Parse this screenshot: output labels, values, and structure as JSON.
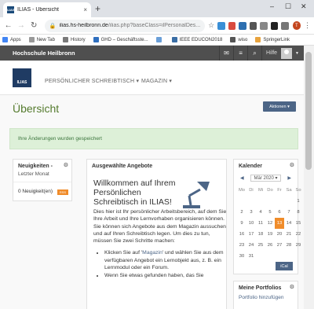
{
  "browser": {
    "tab_title": "ILIAS - Übersicht",
    "tab_favicon": "ILIAS",
    "tab_close": "×",
    "new_tab": "+",
    "window_controls": [
      "–",
      "☐",
      "✕"
    ],
    "nav": {
      "back": "←",
      "forward": "→",
      "reload": "↻"
    },
    "url_host": "ilias.hs-heilbronn.de",
    "url_path": "/ilias.php?baseClass=ilPersonalDes...",
    "profile_initial": "T",
    "bookmarks": [
      {
        "label": "Apps",
        "color": "#4285f4"
      },
      {
        "label": "New Tab",
        "color": "#999999"
      },
      {
        "label": "History",
        "color": "#7a7a7a"
      },
      {
        "label": "GHD – Geschäftsste...",
        "color": "#2f6fbf"
      },
      {
        "label": "",
        "color": "#6a9fd8"
      },
      {
        "label": "IEEE EDUCON2018",
        "color": "#3a6ea5"
      },
      {
        "label": "wiso",
        "color": "#555555"
      },
      {
        "label": "SpringerLink",
        "color": "#e8a33d"
      }
    ]
  },
  "header": {
    "brand": "Hochschule Heilbronn",
    "help": "Hilfe",
    "caret": "▼"
  },
  "mainmenu": {
    "logo_text": "ILIAS",
    "items": [
      "PERSÖNLICHER SCHREIBTISCH ▾",
      "MAGAZIN ▾"
    ]
  },
  "page": {
    "title": "Übersicht",
    "actions_label": "Aktionen ▾",
    "alert": "Ihre Änderungen wurden gespeichert"
  },
  "news": {
    "title": "Neuigkeiten -",
    "subtitle": "Letzter Monat",
    "count": "0 Neuigkeit(en)",
    "rss": "RSS"
  },
  "offers": {
    "title": "Ausgewählte Angebote",
    "welcome": "Willkommen auf Ihrem Persönlichen Schreibtisch in ILIAS!",
    "para": "Dies hier ist Ihr persönlicher Arbeitsbereich, auf dem Sie Ihre Arbeit und Ihre Lernvorhaben organisieren können. Sie können sich Angebote aus dem Magazin aussuchen und auf Ihren Schreibtisch legen. Um dies zu tun, müssen Sie zwei Schritte machen:",
    "bullet1_pre": "Klicken Sie auf '",
    "bullet1_link": "Magazin",
    "bullet1_post": "' und wählen Sie aus dem verfügbaren Angebot ein Lernobjekt aus, z. B. ein Lernmodul oder ein Forum.",
    "bullet2": "Wenn Sie etwas gefunden haben, das Sie"
  },
  "calendar": {
    "title": "Kalender",
    "prev": "◀",
    "next": "▶",
    "month": "Mär 2020 ▾",
    "weekdays": [
      "Mo",
      "Di",
      "Mi",
      "Do",
      "Fr",
      "Sa",
      "So"
    ],
    "days": [
      "",
      "",
      "",
      "",
      "",
      "",
      "1",
      "2",
      "3",
      "4",
      "5",
      "6",
      "7",
      "8",
      "9",
      "10",
      "11",
      "12",
      "13",
      "14",
      "15",
      "16",
      "17",
      "18",
      "19",
      "20",
      "21",
      "22",
      "23",
      "24",
      "25",
      "26",
      "27",
      "28",
      "29",
      "30",
      "31",
      "",
      "",
      "",
      "",
      ""
    ],
    "today": "13",
    "ical": "iCal"
  },
  "portfolios": {
    "title": "Meine Portfolios",
    "link": "Portfolio hinzufügen"
  },
  "icons": {
    "gear": "⚙",
    "mail": "✉",
    "menu": "≡",
    "search": "⌕",
    "lock": "🔒",
    "star": "☆",
    "kebab": "⋮"
  }
}
